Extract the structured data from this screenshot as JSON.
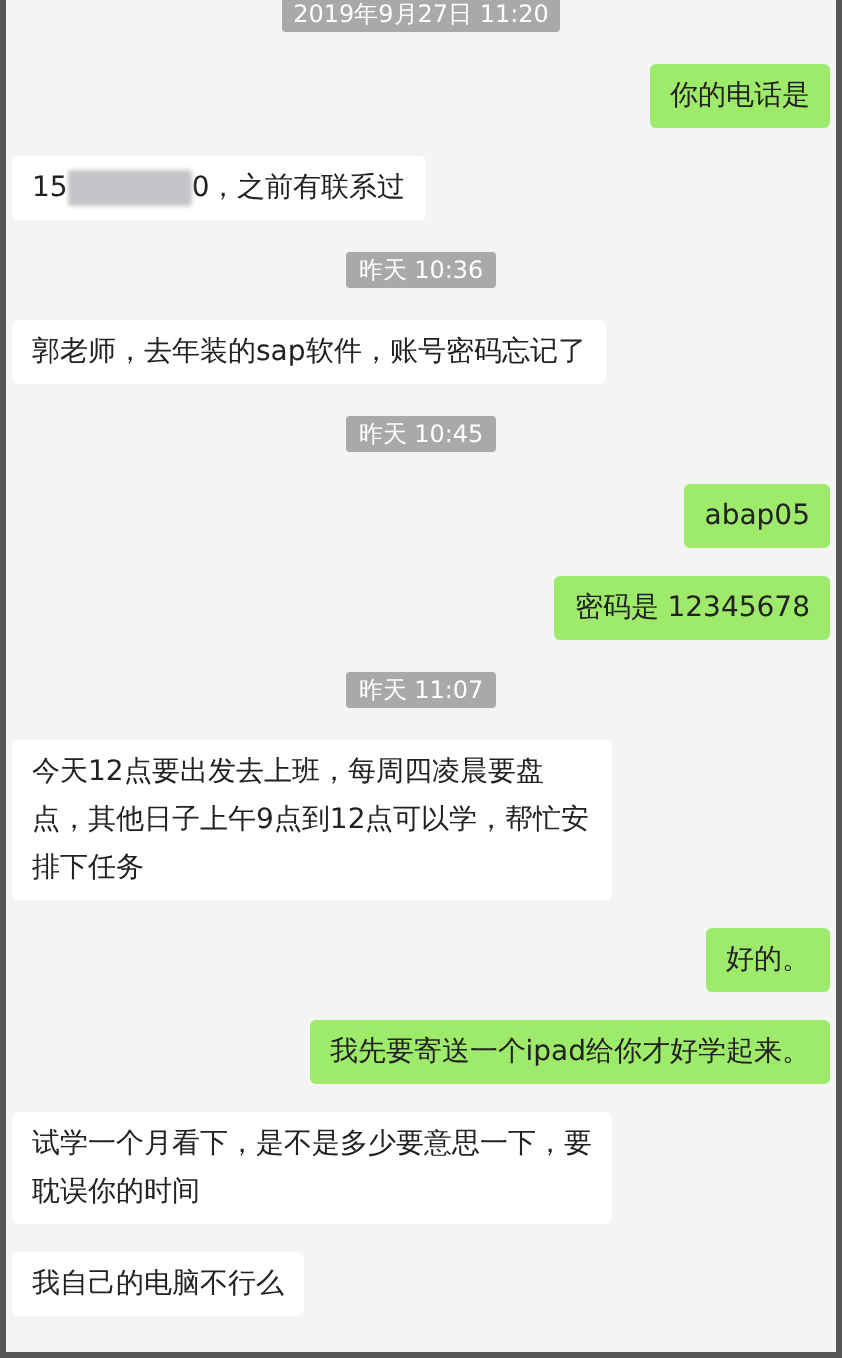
{
  "messages": [
    {
      "kind": "time",
      "text": "2019年9月27日 11:20"
    },
    {
      "kind": "sent",
      "text": "你的电话是"
    },
    {
      "kind": "redacted",
      "prefix": "15",
      "suffix": "0，之前有联系过"
    },
    {
      "kind": "time",
      "text": "昨天 10:36"
    },
    {
      "kind": "received",
      "text": "郭老师，去年装的sap软件，账号密码忘记了"
    },
    {
      "kind": "time",
      "text": "昨天 10:45"
    },
    {
      "kind": "sent",
      "text": "abap05"
    },
    {
      "kind": "sent",
      "text": "密码是 12345678"
    },
    {
      "kind": "time",
      "text": "昨天 11:07"
    },
    {
      "kind": "received",
      "text": "今天12点要出发去上班，每周四凌晨要盘点，其他日子上午9点到12点可以学，帮忙安排下任务"
    },
    {
      "kind": "sent",
      "text": "好的。"
    },
    {
      "kind": "sent",
      "text": "我先要寄送一个ipad给你才好学起来。"
    },
    {
      "kind": "received",
      "text": "试学一个月看下，是不是多少要意思一下，要耽误你的时间"
    },
    {
      "kind": "received",
      "text": "我自己的电脑不行么"
    }
  ]
}
